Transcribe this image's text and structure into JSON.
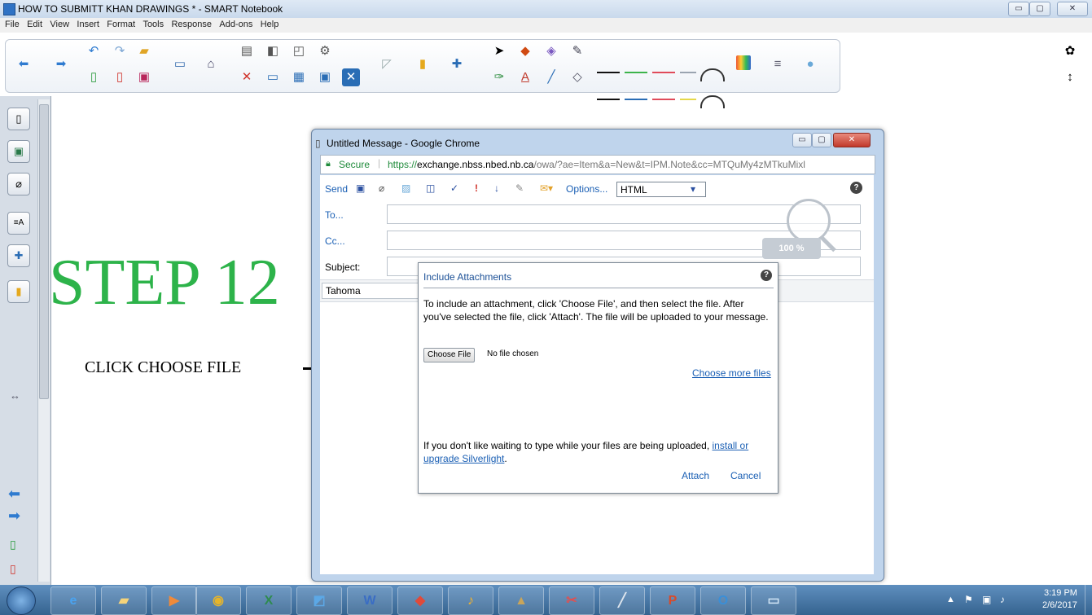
{
  "window": {
    "title": "HOW TO SUBMITT KHAN DRAWINGS * - SMART Notebook"
  },
  "menu": [
    "File",
    "Edit",
    "View",
    "Insert",
    "Format",
    "Tools",
    "Response",
    "Add-ons",
    "Help"
  ],
  "canvas": {
    "step_title": "STEP 12",
    "instruction": "CLICK CHOOSE FILE"
  },
  "browser": {
    "title": "Untitled Message - Google Chrome",
    "secure_label": "Secure",
    "url_prefix": "https://",
    "url_host": "exchange.nbss.nbed.nb.ca",
    "url_path": "/owa/?ae=Item&a=New&t=IPM.Note&cc=MTQuMy4zMTkuMixl"
  },
  "owa": {
    "send_label": "Send",
    "options_label": "Options...",
    "format_value": "HTML",
    "to_label": "To...",
    "cc_label": "Cc...",
    "subject_label": "Subject:",
    "font_value": "Tahoma"
  },
  "dialog": {
    "title": "Include Attachments",
    "instructions": "To include an attachment, click 'Choose File', and then select the file. After you've selected the file, click 'Attach'. The file will be uploaded to your message.",
    "choose_file_label": "Choose File",
    "no_file_text": "No file chosen",
    "choose_more_label": "Choose more files",
    "silverlight_text": "If you don't like waiting to type while your files are being uploaded, ",
    "silverlight_link": "install or upgrade Silverlight",
    "silverlight_end": ".",
    "attach_label": "Attach",
    "cancel_label": "Cancel"
  },
  "zoom_badge": "100 %",
  "clock": {
    "time": "3:19 PM",
    "date": "2/6/2017"
  },
  "colors": {
    "step_green": "#2db34a",
    "link_blue": "#1a5fb4",
    "taskbar": "#35638f"
  }
}
